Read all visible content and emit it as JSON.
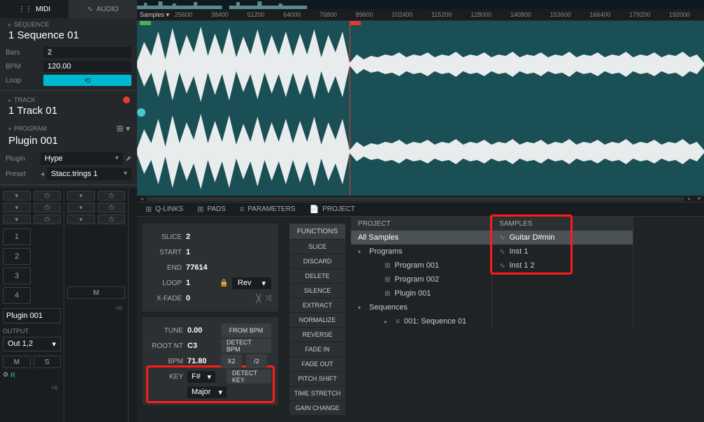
{
  "tabs": {
    "midi": "MIDI",
    "audio": "AUDIO"
  },
  "sequence": {
    "label": "SEQUENCE",
    "value": "1 Sequence 01"
  },
  "params": {
    "bars_lbl": "Bars",
    "bars_val": "2",
    "bpm_lbl": "BPM",
    "bpm_val": "120.00",
    "loop_lbl": "Loop",
    "loop_icon": "⟲"
  },
  "track": {
    "label": "TRACK",
    "value": "1 Track 01"
  },
  "program": {
    "label": "PROGRAM",
    "value": "Plugin 001"
  },
  "plugin": {
    "lbl": "Plugin",
    "val": "Hype"
  },
  "preset": {
    "lbl": "Preset",
    "val": "Stacc.trings 1"
  },
  "pad_nums": [
    "1",
    "2",
    "3",
    "4"
  ],
  "mixer": {
    "prog_name": "Plugin 001",
    "out_lbl": "OUTPUT",
    "out_val": "Out 1,2",
    "m": "M",
    "s": "S",
    "r": "R",
    "plus6": "+6"
  },
  "ruler": {
    "label": "Samples",
    "ticks": [
      "25600",
      "38400",
      "51200",
      "64000",
      "76800",
      "89600",
      "102400",
      "115200",
      "128000",
      "140800",
      "153600",
      "166400",
      "179200",
      "192000"
    ]
  },
  "bottom_tabs": {
    "qlinks": "Q-LINKS",
    "pads": "PADS",
    "parameters": "PARAMETERS",
    "project": "PROJECT"
  },
  "slice": {
    "slice_lbl": "SLICE",
    "slice_val": "2",
    "start_lbl": "START",
    "start_val": "1",
    "end_lbl": "END",
    "end_val": "77614",
    "loop_lbl": "LOOP",
    "loop_val": "1",
    "rev": "Rev",
    "xfade_lbl": "X-FADE",
    "xfade_val": "0"
  },
  "tune": {
    "tune_lbl": "TUNE",
    "tune_val": "0.00",
    "from_bpm": "FROM BPM",
    "root_lbl": "ROOT NT",
    "root_val": "C3",
    "detect_bpm": "DETECT BPM",
    "bpm_lbl": "BPM",
    "bpm_val": "71.80",
    "x2": "X2",
    "d2": "/2",
    "key_lbl": "KEY",
    "key_val": "F#",
    "detect_key": "DETECT KEY",
    "scale_val": "Major"
  },
  "functions": {
    "hdr": "FUNCTIONS",
    "items": [
      "SLICE",
      "DISCARD",
      "DELETE",
      "SILENCE",
      "EXTRACT",
      "NORMALIZE",
      "REVERSE",
      "FADE IN",
      "FADE OUT",
      "PITCH SHIFT",
      "TIME STRETCH",
      "GAIN CHANGE"
    ]
  },
  "project_tree": {
    "hdr": "PROJECT",
    "all": "All Samples",
    "programs": "Programs",
    "p1": "Program 001",
    "p2": "Program 002",
    "p3": "Plugin 001",
    "sequences": "Sequences",
    "seq1": "001: Sequence 01"
  },
  "samples": {
    "hdr": "SAMPLES",
    "items": [
      "Guitar D#min",
      "Inst 1",
      "Inst 1 2"
    ]
  }
}
